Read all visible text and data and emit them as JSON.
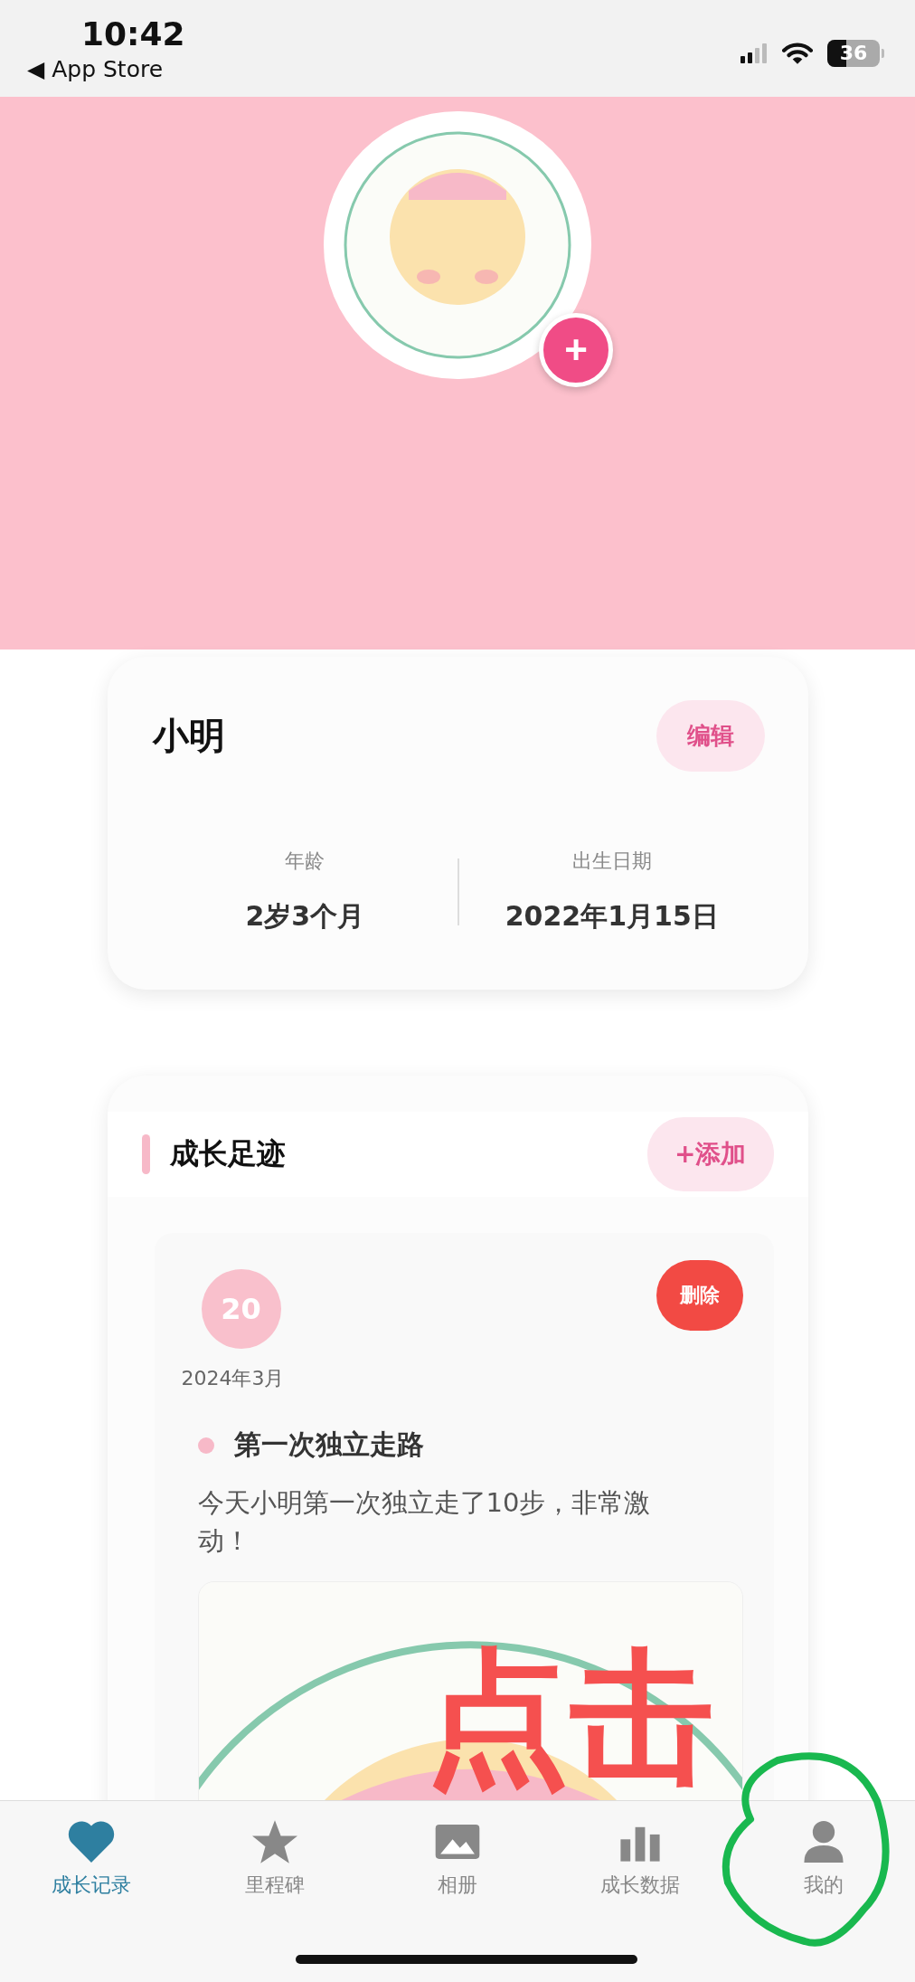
{
  "status_bar": {
    "time": "10:42",
    "back_label": "App Store",
    "back_arrow": "◀",
    "battery": "36"
  },
  "header": {
    "avatar_add": "+"
  },
  "profile": {
    "name": "小明",
    "edit_button": "编辑",
    "stats": [
      {
        "label": "年龄",
        "value": "2岁3个月"
      },
      {
        "label": "出生日期",
        "value": "2022年1月15日"
      }
    ]
  },
  "timeline": {
    "title": "成长足迹",
    "add_button": "+添加",
    "entries": [
      {
        "day": "20",
        "delete_button": "删除",
        "month": "2024年3月",
        "title": "第一次独立走路",
        "description": "今天小明第一次独立走了10步，非常激动！"
      }
    ]
  },
  "tab_bar": {
    "tabs": [
      {
        "label": "成长记录",
        "selected": true,
        "circled": false
      },
      {
        "label": "里程碑",
        "selected": false,
        "circled": false
      },
      {
        "label": "相册",
        "selected": false,
        "circled": false
      },
      {
        "label": "成长数据",
        "selected": false,
        "circled": false
      },
      {
        "label": "我的",
        "selected": false,
        "circled": true
      }
    ]
  },
  "annotation": {
    "text": "点击"
  }
}
